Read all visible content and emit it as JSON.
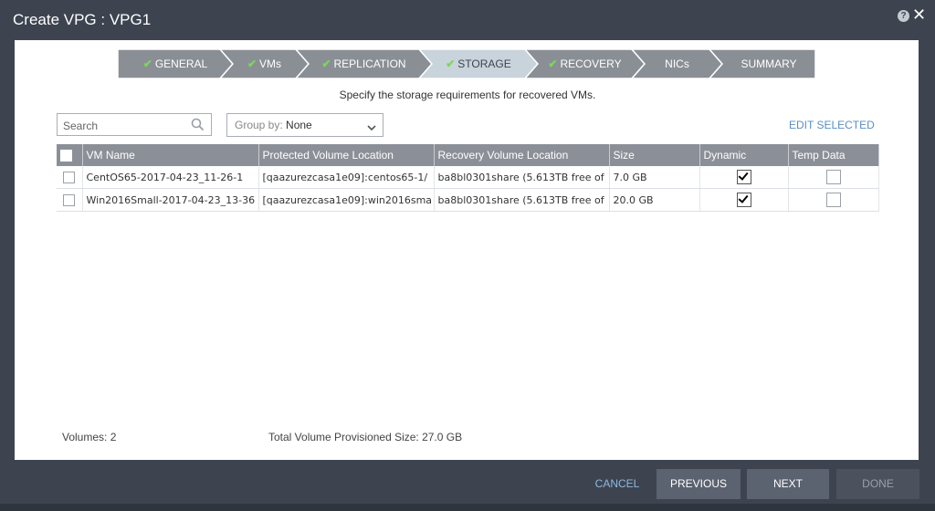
{
  "window": {
    "title": "Create VPG : VPG1"
  },
  "wizard": {
    "steps": [
      {
        "label": "GENERAL",
        "done": true
      },
      {
        "label": "VMs",
        "done": true
      },
      {
        "label": "REPLICATION",
        "done": true
      },
      {
        "label": "STORAGE",
        "done": true,
        "active": true
      },
      {
        "label": "RECOVERY",
        "done": true
      },
      {
        "label": "NICs",
        "done": false
      },
      {
        "label": "SUMMARY",
        "done": false
      }
    ],
    "colors": {
      "step": "#8a8f96",
      "active": "#c9d3dc",
      "check": "#7dd65a"
    }
  },
  "subtitle": "Specify the storage requirements for recovered VMs.",
  "search": {
    "placeholder": "Search",
    "value": ""
  },
  "groupby": {
    "label": "Group by:",
    "value": "None"
  },
  "edit_selected": "EDIT SELECTED",
  "table": {
    "columns": [
      "VM Name",
      "Protected Volume Location",
      "Recovery Volume Location",
      "Size",
      "Dynamic",
      "Temp Data"
    ],
    "rows": [
      {
        "vm_name": "CentOS65-2017-04-23_11-26-1",
        "protected": "[qaazurezcasa1e09]:centos65-1/",
        "recovery": "ba8bl0301share (5.613TB free of",
        "size": "7.0 GB",
        "dynamic": true,
        "temp_data": false
      },
      {
        "vm_name": "Win2016Small-2017-04-23_13-36",
        "protected": "[qaazurezcasa1e09]:win2016sma",
        "recovery": "ba8bl0301share (5.613TB free of",
        "size": "20.0 GB",
        "dynamic": true,
        "temp_data": false
      }
    ]
  },
  "footer": {
    "volumes": "Volumes: 2",
    "total": "Total Volume Provisioned Size: 27.0 GB"
  },
  "buttons": {
    "cancel": "CANCEL",
    "previous": "PREVIOUS",
    "next": "NEXT",
    "done": "DONE"
  }
}
